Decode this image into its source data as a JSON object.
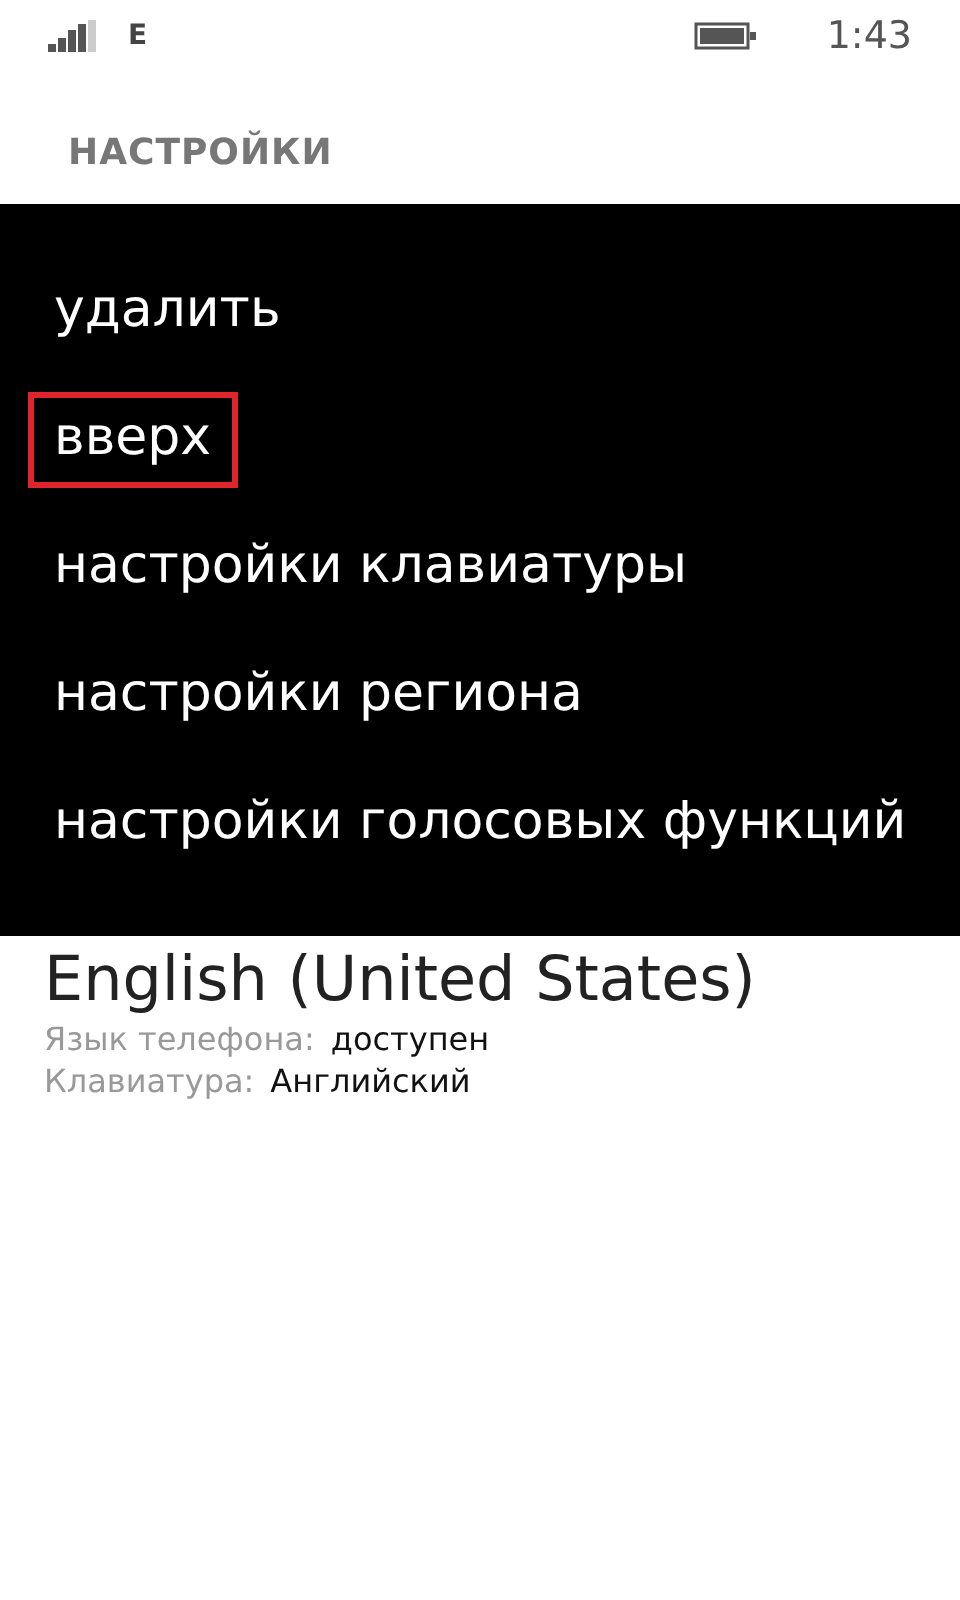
{
  "status_bar": {
    "network": "E",
    "time": "1:43"
  },
  "header": {
    "title": "НАСТРОЙКИ"
  },
  "context_menu": {
    "items": [
      {
        "label": "удалить",
        "marked": false
      },
      {
        "label": "вверх",
        "marked": true
      },
      {
        "label": "настройки клавиатуры",
        "marked": false
      },
      {
        "label": "настройки региона",
        "marked": false
      },
      {
        "label": "настройки голосовых функций",
        "marked": false
      }
    ]
  },
  "language": {
    "name": "English (United States)",
    "details": [
      {
        "label": "Язык телефона:",
        "value": "доступен"
      },
      {
        "label": "Клавиатура:",
        "value": "Английский"
      }
    ]
  }
}
